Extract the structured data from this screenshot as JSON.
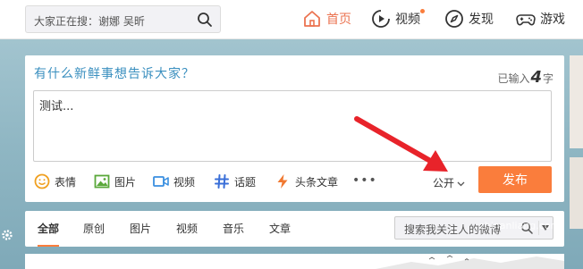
{
  "colors": {
    "accent": "#fa7d3c",
    "active_nav": "#eb7350",
    "prompt_blue": "#3a8fbf"
  },
  "header": {
    "search_placeholder": "大家正在搜：谢娜 吴昕",
    "nav": [
      {
        "label": "首页",
        "icon": "home-icon",
        "active": true
      },
      {
        "label": "视频",
        "icon": "video-play-icon",
        "badge_dot": true
      },
      {
        "label": "发现",
        "icon": "compass-icon"
      },
      {
        "label": "游戏",
        "icon": "gamepad-icon"
      }
    ]
  },
  "composer": {
    "prompt": "有什么新鲜事想告诉大家？",
    "counter_prefix": "已输入",
    "counter_value": "4",
    "counter_suffix": "字",
    "text": "测试...",
    "tools": [
      {
        "label": "表情",
        "icon": "smile-icon"
      },
      {
        "label": "图片",
        "icon": "image-icon"
      },
      {
        "label": "视频",
        "icon": "video-camera-icon"
      },
      {
        "label": "话题",
        "icon": "hashtag-icon"
      },
      {
        "label": "头条文章",
        "icon": "lightning-icon"
      }
    ],
    "more": "•••",
    "visibility": "公开",
    "publish": "发布"
  },
  "feed": {
    "tabs": [
      "全部",
      "原创",
      "图片",
      "视频",
      "音乐",
      "文章"
    ],
    "search_placeholder": "搜索我关注人的微博"
  },
  "watermark": "zhinanliang.com"
}
